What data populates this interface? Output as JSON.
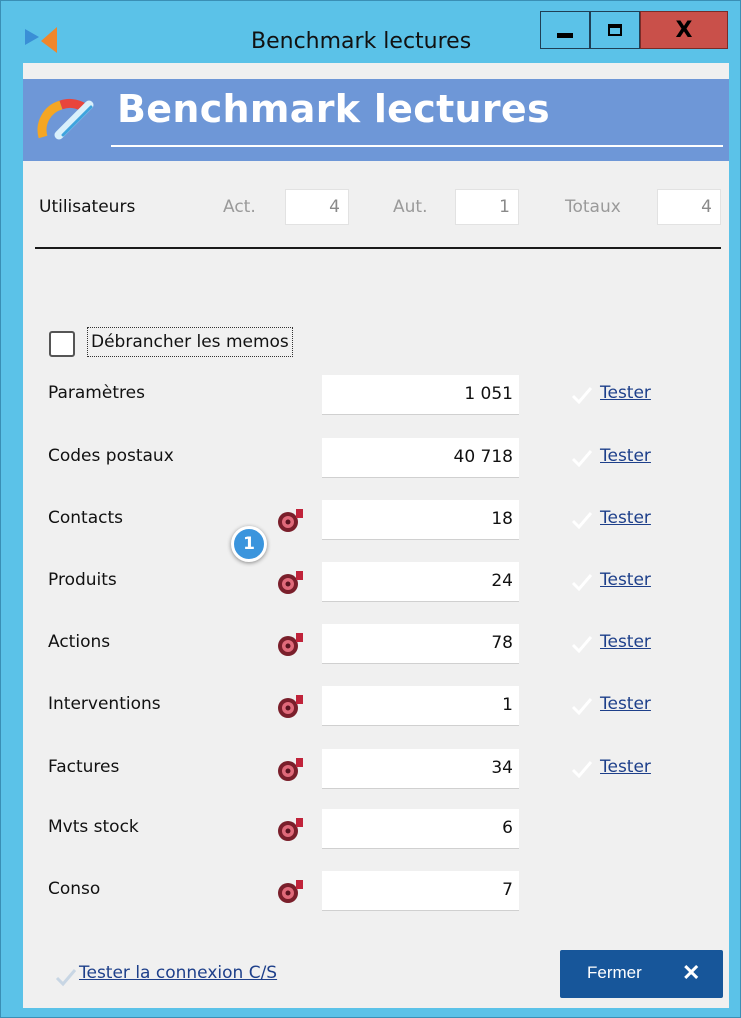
{
  "window": {
    "title": "Benchmark lectures",
    "close_glyph": "X",
    "colors": {
      "frame": "#5bc2e8",
      "close": "#c9504a"
    }
  },
  "banner": {
    "title": "Benchmark lectures",
    "icon": "speedometer-icon",
    "color": "#6e97d7"
  },
  "users": {
    "label": "Utilisateurs",
    "act_label": "Act.",
    "act_value": "4",
    "aut_label": "Aut.",
    "aut_value": "1",
    "total_label": "Totaux",
    "total_value": "4"
  },
  "memos_checkbox": {
    "label": "Débrancher les memos",
    "checked": false
  },
  "rows": [
    {
      "label": "Paramètres",
      "value": "1 051",
      "has_icon": false,
      "has_test": true,
      "test_label": "Tester"
    },
    {
      "label": "Codes postaux",
      "value": "40 718",
      "has_icon": false,
      "has_test": true,
      "test_label": "Tester"
    },
    {
      "label": "Contacts",
      "value": "18",
      "has_icon": true,
      "has_test": true,
      "test_label": "Tester"
    },
    {
      "label": "Produits",
      "value": "24",
      "has_icon": true,
      "has_test": true,
      "test_label": "Tester"
    },
    {
      "label": "Actions",
      "value": "78",
      "has_icon": true,
      "has_test": true,
      "test_label": "Tester"
    },
    {
      "label": "Interventions",
      "value": "1",
      "has_icon": true,
      "has_test": true,
      "test_label": "Tester"
    },
    {
      "label": "Factures",
      "value": "34",
      "has_icon": true,
      "has_test": true,
      "test_label": "Tester"
    },
    {
      "label": "Mvts stock",
      "value": "6",
      "has_icon": true,
      "has_test": false
    },
    {
      "label": "Conso",
      "value": "7",
      "has_icon": true,
      "has_test": false
    }
  ],
  "callout_badge": "1",
  "footer": {
    "test_link": "Tester la connexion C/S",
    "close_label": "Fermer",
    "close_glyph": "✕",
    "close_color": "#17569a"
  }
}
